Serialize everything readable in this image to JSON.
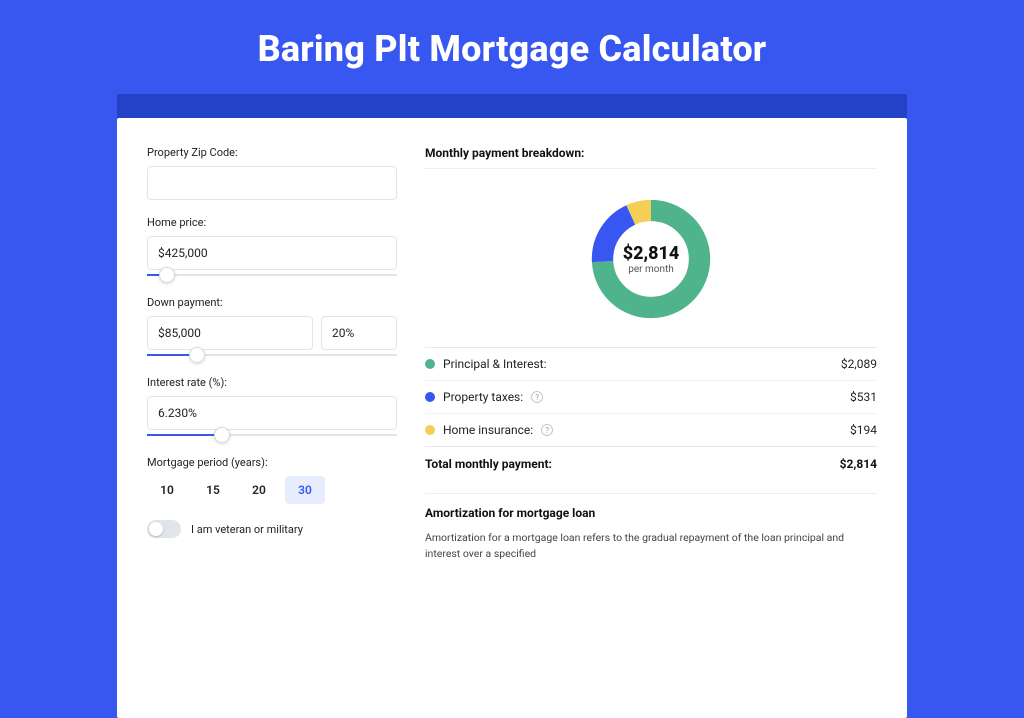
{
  "page_title": "Baring Plt Mortgage Calculator",
  "form": {
    "zip_label": "Property Zip Code:",
    "zip_value": "",
    "home_price_label": "Home price:",
    "home_price_value": "$425,000",
    "home_price_slider_pct": 8,
    "down_payment_label": "Down payment:",
    "down_payment_value": "$85,000",
    "down_payment_pct": "20%",
    "down_payment_slider_pct": 20,
    "interest_label": "Interest rate (%):",
    "interest_value": "6.230%",
    "interest_slider_pct": 30,
    "period_label": "Mortgage period (years):",
    "periods": [
      "10",
      "15",
      "20",
      "30"
    ],
    "period_selected": "30",
    "veteran_label": "I am veteran or military",
    "veteran_on": false
  },
  "breakdown": {
    "title": "Monthly payment breakdown:",
    "donut_amount": "$2,814",
    "donut_sub": "per month",
    "items": [
      {
        "label": "Principal & Interest:",
        "value": "$2,089",
        "color": "green",
        "pct": 74
      },
      {
        "label": "Property taxes:",
        "value": "$531",
        "color": "blue",
        "pct": 19,
        "info": true
      },
      {
        "label": "Home insurance:",
        "value": "$194",
        "color": "yellow",
        "pct": 7,
        "info": true
      }
    ],
    "total_label": "Total monthly payment:",
    "total_value": "$2,814"
  },
  "amortization": {
    "title": "Amortization for mortgage loan",
    "text": "Amortization for a mortgage loan refers to the gradual repayment of the loan principal and interest over a specified"
  },
  "chart_data": {
    "type": "pie",
    "title": "Monthly payment breakdown",
    "series": [
      {
        "name": "Principal & Interest",
        "value": 2089,
        "color": "#4fb38b"
      },
      {
        "name": "Property taxes",
        "value": 531,
        "color": "#3757f0"
      },
      {
        "name": "Home insurance",
        "value": 194,
        "color": "#f3cf58"
      }
    ],
    "total": 2814,
    "center_label": "$2,814 per month"
  }
}
